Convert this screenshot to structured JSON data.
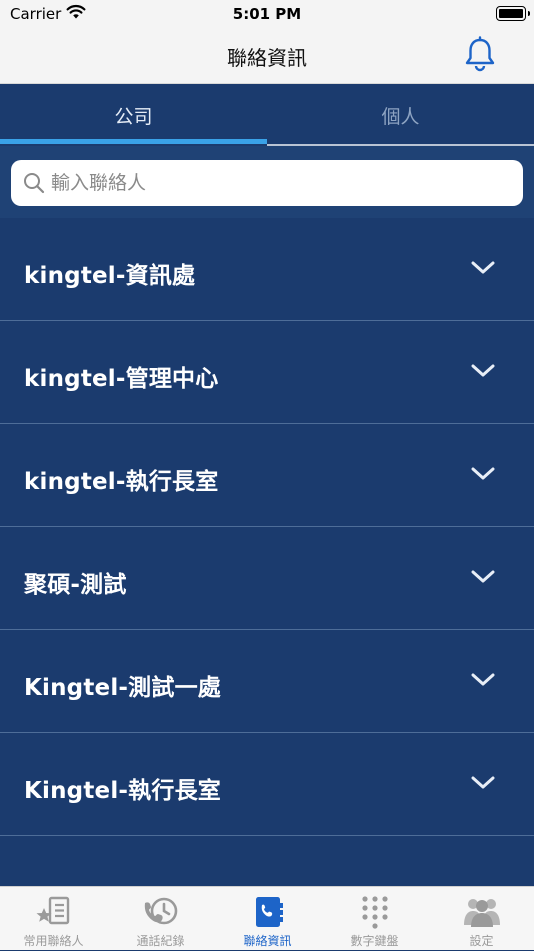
{
  "status_bar": {
    "carrier": "Carrier",
    "time": "5:01 PM"
  },
  "nav": {
    "title": "聯絡資訊",
    "bell_icon": "bell-icon",
    "accent": "#1d64c8"
  },
  "segment_tabs": [
    {
      "label": "公司",
      "selected": true
    },
    {
      "label": "個人",
      "selected": false
    }
  ],
  "search": {
    "value": "",
    "placeholder": "輸入聯絡人",
    "icon": "search-icon"
  },
  "groups": [
    {
      "label": "kingtel-資訊處",
      "icon": "chevron-down-icon"
    },
    {
      "label": "kingtel-管理中心",
      "icon": "chevron-down-icon"
    },
    {
      "label": "kingtel-執行長室",
      "icon": "chevron-down-icon"
    },
    {
      "label": "聚碩-測試",
      "icon": "chevron-down-icon"
    },
    {
      "label": "Kingtel-測試一處",
      "icon": "chevron-down-icon"
    },
    {
      "label": "Kingtel-執行長室",
      "icon": "chevron-down-icon"
    }
  ],
  "tab_bar": [
    {
      "label": "常用聯絡人",
      "icon": "favorites-list-icon",
      "selected": false
    },
    {
      "label": "通話紀錄",
      "icon": "call-history-icon",
      "selected": false
    },
    {
      "label": "聯絡資訊",
      "icon": "contacts-book-icon",
      "selected": true
    },
    {
      "label": "數字鍵盤",
      "icon": "keypad-icon",
      "selected": false
    },
    {
      "label": "設定",
      "icon": "users-settings-icon",
      "selected": false
    }
  ],
  "colors": {
    "background": "#1b3b6e",
    "tab_indicator": "#3aa2e8",
    "tab_selected": "#1d64c8"
  }
}
